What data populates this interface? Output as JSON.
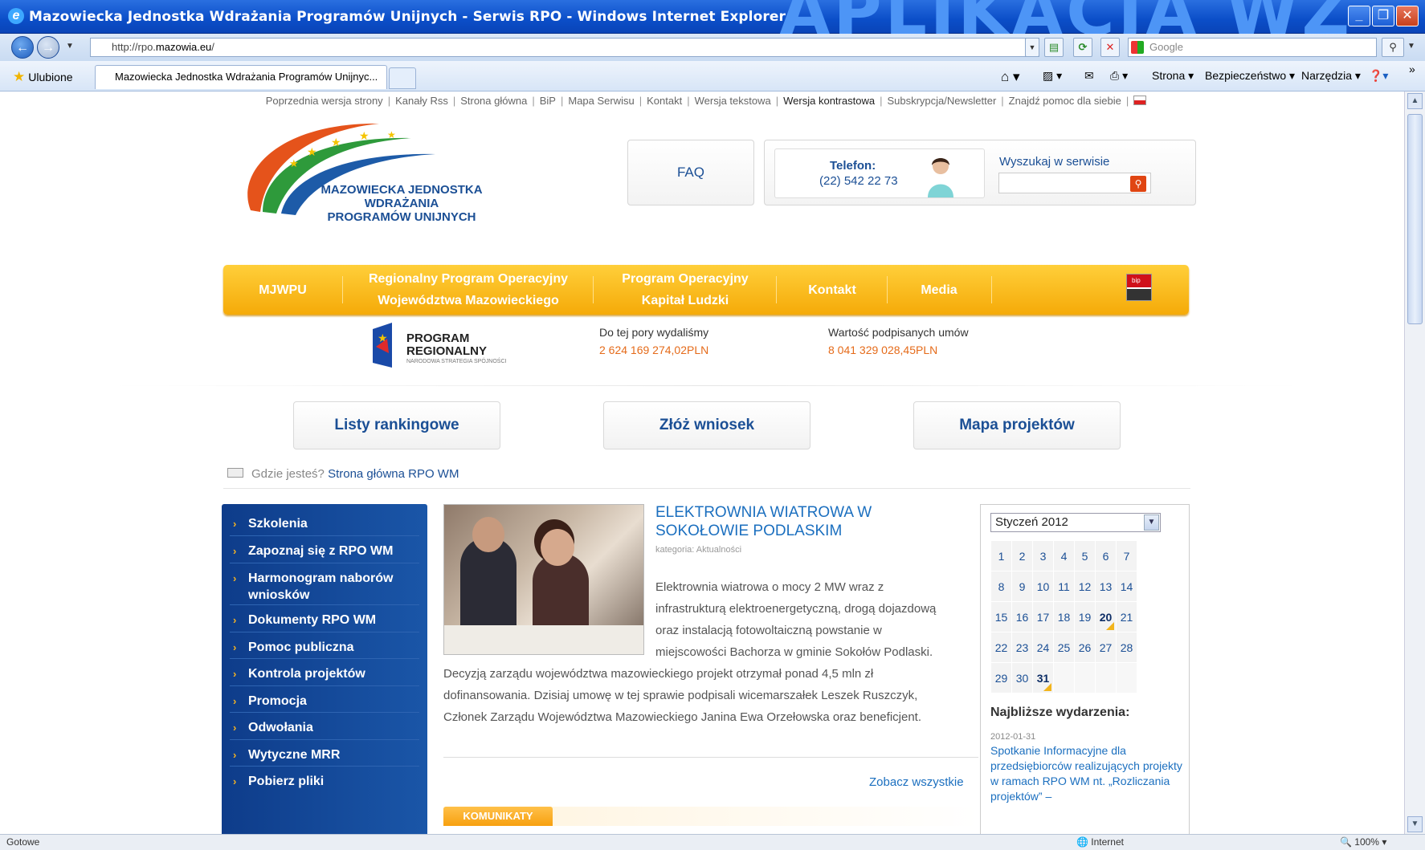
{
  "window": {
    "title": "Mazowiecka Jednostka Wdrażania Programów Unijnych - Serwis RPO - Windows Internet Explorer",
    "overlay_text": "APLIKACJA WZ"
  },
  "address_bar": {
    "url_prefix": "http://rpo.",
    "url_domain": "mazowia.eu",
    "url_suffix": "/",
    "search_placeholder": "Google"
  },
  "favorites_bar": {
    "favorites_label": "Ulubione",
    "tab_title": "Mazowiecka Jednostka Wdrażania Programów Unijnyc...",
    "commands": [
      "Strona ▾",
      "Bezpieczeństwo ▾",
      "Narzędzia ▾"
    ]
  },
  "status_bar": {
    "left": "Gotowe",
    "zone": "Internet",
    "zoom": "100%"
  },
  "page": {
    "top_links": [
      "Poprzednia wersja strony",
      "Kanały Rss",
      "Strona główna",
      "BiP",
      "Mapa Serwisu",
      "Kontakt",
      "Wersja tekstowa",
      "Wersja kontrastowa",
      "Subskrypcja/Newsletter",
      "Znajdź pomoc dla siebie"
    ],
    "logo_lines": [
      "MAZOWIECKA JEDNOSTKA",
      "WDRAŻANIA",
      "PROGRAMÓW UNIJNYCH"
    ],
    "faq": "FAQ",
    "phone_label": "Telefon:",
    "phone_number": "(22) 542 22 73",
    "search_label": "Wyszukaj w serwisie",
    "menu": [
      {
        "l1": "MJWPU",
        "l2": ""
      },
      {
        "l1": "Regionalny Program Operacyjny",
        "l2": "Województwa Mazowieckiego"
      },
      {
        "l1": "Program Operacyjny",
        "l2": "Kapitał Ludzki"
      },
      {
        "l1": "Kontakt",
        "l2": ""
      },
      {
        "l1": "Media",
        "l2": ""
      }
    ],
    "bip_label": "bip",
    "program_logo": {
      "line1": "PROGRAM",
      "line2": "REGIONALNY",
      "line3": "NARODOWA STRATEGIA SPÓJNOŚCI"
    },
    "stats": [
      {
        "label": "Do tej pory wydaliśmy",
        "value": "2 624 169 274,02PLN"
      },
      {
        "label": "Wartość podpisanych umów",
        "value": "8 041 329 028,45PLN"
      }
    ],
    "big_buttons": [
      "Listy rankingowe",
      "Złóż wniosek",
      "Mapa projektów"
    ],
    "breadcrumb": {
      "prefix": "Gdzie jesteś?",
      "current": "Strona główna RPO WM"
    },
    "sidebar": [
      "Szkolenia",
      "Zapoznaj się z RPO WM",
      "Harmonogram naborów wniosków",
      "Dokumenty RPO WM",
      "Pomoc publiczna",
      "Kontrola projektów",
      "Promocja",
      "Odwołania",
      "Wytyczne MRR",
      "Pobierz pliki"
    ],
    "article": {
      "title": "ELEKTROWNIA WIATROWA W SOKOŁOWIE PODLASKIM",
      "category": "kategoria: Aktualności",
      "lines_indented": [
        "Elektrownia wiatrowa o mocy 2 MW wraz z",
        "infrastrukturą elektroenergetyczną, drogą dojazdową",
        "oraz instalacją fotowoltaiczną powstanie w",
        "miejscowości Bachorza w gminie Sokołów Podlaski."
      ],
      "lines_full": [
        "Decyzją zarządu województwa mazowieckiego projekt otrzymał ponad 4,5 mln zł",
        "dofinansowania. Dzisiaj umowę w tej sprawie podpisali wicemarszałek Leszek Ruszczyk,",
        "Członek Zarządu Województwa Mazowieckiego Janina Ewa Orzełowska oraz beneficjent."
      ],
      "see_all": "Zobacz wszystkie"
    },
    "komunikaty": "KOMUNIKATY",
    "calendar": {
      "month": "Styczeń 2012",
      "weeks": [
        [
          "1",
          "2",
          "3",
          "4",
          "5",
          "6",
          "7"
        ],
        [
          "8",
          "9",
          "10",
          "11",
          "12",
          "13",
          "14"
        ],
        [
          "15",
          "16",
          "17",
          "18",
          "19",
          "20",
          "21"
        ],
        [
          "22",
          "23",
          "24",
          "25",
          "26",
          "27",
          "28"
        ],
        [
          "29",
          "30",
          "31",
          "",
          "",
          "",
          ""
        ]
      ],
      "marked_days": [
        "20",
        "31"
      ]
    },
    "events": {
      "heading": "Najbliższe wydarzenia:",
      "date": "2012-01-31",
      "text": "Spotkanie Informacyjne dla przedsiębiorców realizujących projekty w ramach RPO WM nt. „Rozliczania projektów” –"
    }
  }
}
